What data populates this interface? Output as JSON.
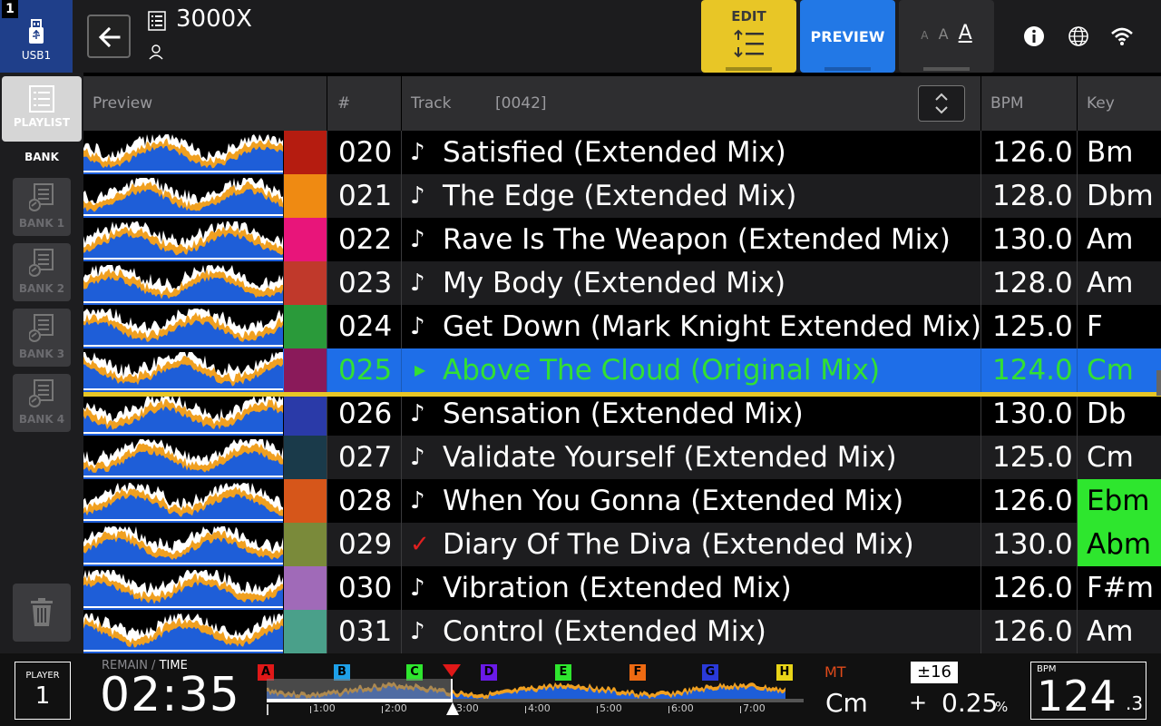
{
  "source": {
    "slot": "1",
    "label": "USB1"
  },
  "header": {
    "title": "3000X"
  },
  "toolbar": {
    "edit_label": "EDIT",
    "preview_label": "PREVIEW",
    "font_sizes": [
      "A",
      "A",
      "A"
    ]
  },
  "sidebar": {
    "playlist_label": "PLAYLIST",
    "bank_title": "BANK",
    "banks": [
      "BANK 1",
      "BANK 2",
      "BANK 3",
      "BANK 4"
    ]
  },
  "table": {
    "columns": {
      "preview": "Preview",
      "number": "#",
      "track": "Track",
      "count": "[0042]",
      "bpm": "BPM",
      "key": "Key"
    },
    "rows": [
      {
        "num": "020",
        "title": "Satisfied (Extended Mix)",
        "bpm": "126.0",
        "key": "Bm",
        "art": "#b51c10",
        "status": "note"
      },
      {
        "num": "021",
        "title": "The Edge (Extended Mix)",
        "bpm": "128.0",
        "key": "Dbm",
        "art": "#ef8a12",
        "status": "note"
      },
      {
        "num": "022",
        "title": "Rave Is The Weapon (Extended Mix)",
        "bpm": "130.0",
        "key": "Am",
        "art": "#e8157a",
        "status": "note"
      },
      {
        "num": "023",
        "title": "My Body (Extended Mix)",
        "bpm": "128.0",
        "key": "Am",
        "art": "#c0392b",
        "status": "note"
      },
      {
        "num": "024",
        "title": "Get Down (Mark Knight Extended Mix)",
        "bpm": "125.0",
        "key": "F",
        "art": "#2a9a3a",
        "status": "note"
      },
      {
        "num": "025",
        "title": "Above The Cloud (Original Mix)",
        "bpm": "124.0",
        "key": "Cm",
        "art": "#8a1a5a",
        "status": "playing",
        "selected": true
      },
      {
        "num": "026",
        "title": "Sensation (Extended Mix)",
        "bpm": "130.0",
        "key": "Db",
        "art": "#2a3aa8",
        "status": "note"
      },
      {
        "num": "027",
        "title": "Validate Yourself (Extended Mix)",
        "bpm": "125.0",
        "key": "Cm",
        "art": "#1a3a4a",
        "status": "note"
      },
      {
        "num": "028",
        "title": "When You Gonna (Extended Mix)",
        "bpm": "126.0",
        "key": "Ebm",
        "art": "#d6561a",
        "status": "note",
        "key_highlight": "#2ee62e"
      },
      {
        "num": "029",
        "title": "Diary Of The Diva (Extended Mix)",
        "bpm": "130.0",
        "key": "Abm",
        "art": "#7a8a3a",
        "status": "played",
        "key_highlight": "#2ee62e"
      },
      {
        "num": "030",
        "title": "Vibration (Extended Mix)",
        "bpm": "126.0",
        "key": "F#m",
        "art": "#a06ab8",
        "status": "note"
      },
      {
        "num": "031",
        "title": "Control (Extended Mix)",
        "bpm": "126.0",
        "key": "Am",
        "art": "#4aa08a",
        "status": "note"
      }
    ]
  },
  "player": {
    "label": "PLAYER",
    "number": "1",
    "time_label_remain": "REMAIN",
    "time_label_sep": " / ",
    "time_label_time": "TIME",
    "time": "02:35",
    "hotcues": [
      {
        "label": "A",
        "color": "#e01818"
      },
      {
        "label": "B",
        "color": "#1ea0e8"
      },
      {
        "label": "C",
        "color": "#2ee62e"
      },
      {
        "label": "D",
        "color": "#6a1ae8"
      },
      {
        "label": "E",
        "color": "#2ee62e"
      },
      {
        "label": "F",
        "color": "#ee6a12"
      },
      {
        "label": "G",
        "color": "#2a3ad8"
      },
      {
        "label": "H",
        "color": "#e8d418"
      }
    ],
    "timeline": [
      "1:00",
      "2:00",
      "3:00",
      "4:00",
      "5:00",
      "6:00",
      "7:00"
    ],
    "mt_label": "MT",
    "key": "Cm",
    "tempo_range": "±16",
    "tempo_sign": "+",
    "tempo_value": "0.25",
    "tempo_unit": "%",
    "bpm_label": "BPM",
    "bpm_int": "124",
    "bpm_dec": ".3"
  }
}
